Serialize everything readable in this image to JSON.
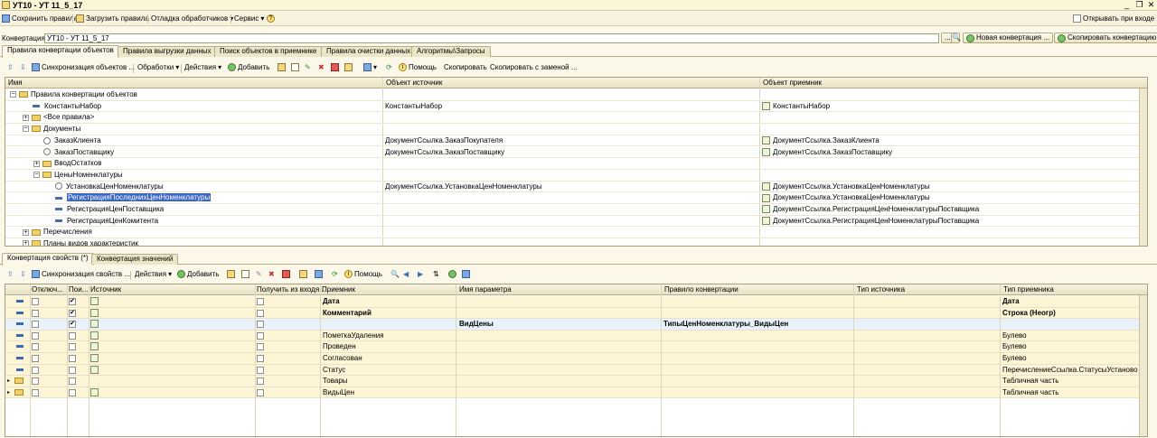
{
  "window": {
    "title": "УТ10 - УТ 11_5_17"
  },
  "menu": {
    "save": "Сохранить правила",
    "load": "Загрузить правила",
    "debug": "Отладка обработчиков",
    "service": "Сервис",
    "open_on_start": "Открывать при входе"
  },
  "conversion": {
    "label": "Конвертация:",
    "value": "УТ10 - УТ 11_5_17",
    "search_btn": "...",
    "new_btn": "Новая конвертация ...",
    "copy_btn": "Скопировать конвертацию"
  },
  "tabs": [
    "Правила конвертации объектов",
    "Правила выгрузки данных",
    "Поиск объектов в приемнике",
    "Правила очистки данных",
    "Алгоритмы\\Запросы"
  ],
  "toolbar1": {
    "sync": "Синхронизация объектов ...",
    "handlers": "Обработки",
    "actions": "Действия",
    "add": "Добавить",
    "help": "Помощь",
    "copy": "Скопировать",
    "copy_replace": "Скопировать с заменой ..."
  },
  "tree": {
    "columns": [
      "Имя",
      "Объект источник",
      "Объект приемник"
    ],
    "rows": [
      {
        "name": "Правила конвертации объектов",
        "src": "",
        "dst": ""
      },
      {
        "name": "КонстантыНабор",
        "src": "КонстантыНабор",
        "dst": "КонстантыНабор"
      },
      {
        "name": "<Все правила>",
        "src": "",
        "dst": ""
      },
      {
        "name": "Документы",
        "src": "",
        "dst": ""
      },
      {
        "name": "ЗаказКлиента",
        "src": "ДокументСсылка.ЗаказПокупателя",
        "dst": "ДокументСсылка.ЗаказКлиента"
      },
      {
        "name": "ЗаказПоставщику",
        "src": "ДокументСсылка.ЗаказПоставщику",
        "dst": "ДокументСсылка.ЗаказПоставщику"
      },
      {
        "name": "ВводОстатков",
        "src": "",
        "dst": ""
      },
      {
        "name": "ЦеныНоменклатуры",
        "src": "",
        "dst": ""
      },
      {
        "name": "УстановкаЦенНоменклатуры",
        "src": "ДокументСсылка.УстановкаЦенНоменклатуры",
        "dst": "ДокументСсылка.УстановкаЦенНоменклатуры"
      },
      {
        "name": "РегистрацияПоследнихЦенНоменклатуры",
        "src": "",
        "dst": "ДокументСсылка.УстановкаЦенНоменклатуры"
      },
      {
        "name": "РегистрацияЦенПоставщика",
        "src": "",
        "dst": "ДокументСсылка.РегистрацияЦенНоменклатурыПоставщика"
      },
      {
        "name": "РегистрацияЦенКомитента",
        "src": "",
        "dst": "ДокументСсылка.РегистрацияЦенНоменклатурыПоставщика"
      },
      {
        "name": "Перечисления",
        "src": "",
        "dst": ""
      },
      {
        "name": "Планы видов характеристик",
        "src": "",
        "dst": ""
      }
    ]
  },
  "tabs2": [
    "Конвертация свойств (*)",
    "Конвертация значений"
  ],
  "toolbar2": {
    "sync": "Синхронизация свойств ...",
    "actions": "Действия",
    "add": "Добавить",
    "help": "Помощь"
  },
  "props": {
    "columns": [
      "Отключ...",
      "Пои...",
      "Источник",
      "Получить из входя...",
      "Приемник",
      "Имя параметра",
      "Правило конвертации",
      "Тип источника",
      "Тип приемника"
    ],
    "rows": [
      {
        "dst": "Дата",
        "param": "",
        "rule": "",
        "dsttype": "Дата"
      },
      {
        "dst": "Комментарий",
        "param": "",
        "rule": "",
        "dsttype": "Строка (Неогр)"
      },
      {
        "dst": "",
        "param": "ВидЦены",
        "rule": "ТипыЦенНоменклатуры_ВидыЦен",
        "dsttype": ""
      },
      {
        "dst": "ПометкаУдаления",
        "param": "",
        "rule": "",
        "dsttype": "Булево"
      },
      {
        "dst": "Проведен",
        "param": "",
        "rule": "",
        "dsttype": "Булево"
      },
      {
        "dst": "Согласован",
        "param": "",
        "rule": "",
        "dsttype": "Булево"
      },
      {
        "dst": "Статус",
        "param": "",
        "rule": "",
        "dsttype": "ПеречислениеСсылка.СтатусыУстановок..."
      },
      {
        "dst": "Товары",
        "param": "",
        "rule": "",
        "dsttype": "Табличная часть"
      },
      {
        "dst": "ВидыЦен",
        "param": "",
        "rule": "",
        "dsttype": "Табличная часть"
      }
    ]
  }
}
